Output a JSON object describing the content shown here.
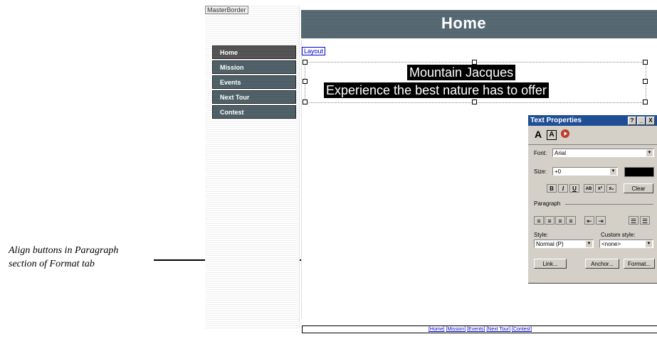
{
  "callout": {
    "line1": "Align buttons in Paragraph",
    "line2": "section of Format tab"
  },
  "editor": {
    "master_border_label": "MasterBorder",
    "layout_label": "Layout",
    "banner_title": "Home",
    "headline_1": "Mountain Jacques",
    "headline_2": "Experience the best nature has to offer"
  },
  "nav": {
    "items": [
      "Home",
      "Mission",
      "Events",
      "Next Tour",
      "Contest"
    ]
  },
  "footer": {
    "links": [
      "[Home]",
      "[Mission]",
      "[Events]",
      "[Next Tour]",
      "[Contest]"
    ]
  },
  "panel": {
    "title": "Text Properties",
    "btn_help": "?",
    "btn_min": "_",
    "btn_close": "X",
    "tab_char": "A",
    "tab_frame": "A",
    "font_label": "Font:",
    "font_value": "Arial",
    "size_label": "Size:",
    "size_value": "+0",
    "bold": "B",
    "italic": "I",
    "underline": "U",
    "smallcaps": "AB",
    "superscript": "x²",
    "subscript": "x₂",
    "clear": "Clear",
    "paragraph_label": "Paragraph",
    "style_label": "Style:",
    "style_value": "Normal (P)",
    "custom_style_label": "Custom style:",
    "custom_style_value": "<none>",
    "link_btn": "Link...",
    "anchor_btn": "Anchor...",
    "format_btn": "Format...",
    "colors": {
      "title_bar": "#1f4e96",
      "swatch": "#000000"
    }
  }
}
